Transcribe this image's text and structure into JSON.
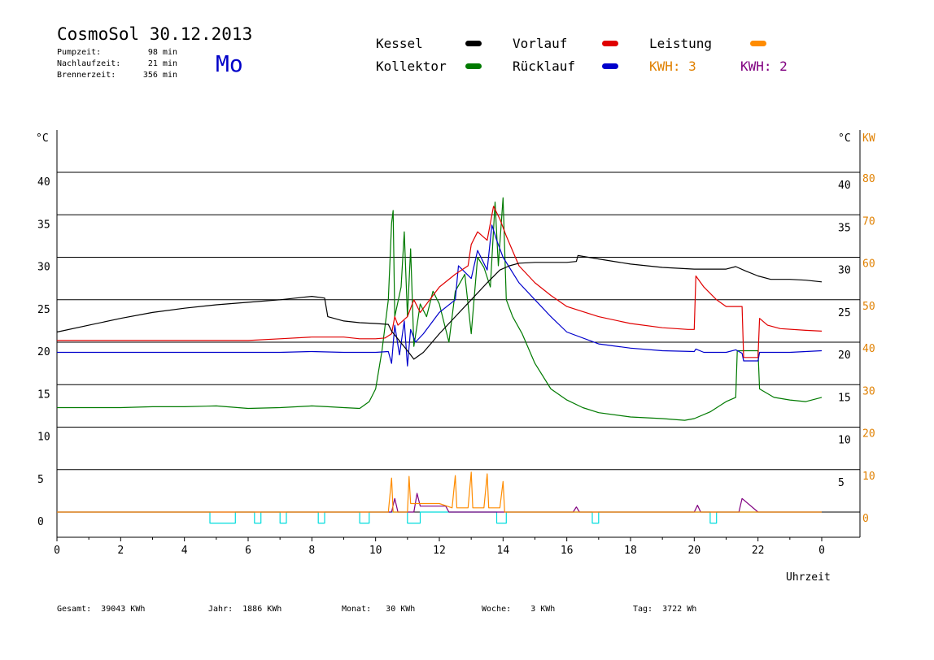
{
  "header": {
    "title": "CosmoSol 30.12.2013",
    "stats": [
      {
        "label": "Pumpzeit:",
        "value": "98 min"
      },
      {
        "label": "Nachlaufzeit:",
        "value": "21 min"
      },
      {
        "label": "Brennerzeit:",
        "value": "356 min"
      }
    ],
    "weekday": "Mo"
  },
  "legend": {
    "kessel": "Kessel",
    "kollektor": "Kollektor",
    "vorlauf": "Vorlauf",
    "ruecklauf": "Rücklauf",
    "leistung": "Leistung",
    "kwh1": "KWH: 3",
    "kwh2": "KWH: 2"
  },
  "footer": {
    "gesamt": "Gesamt:  39043 KWh",
    "jahr": "Jahr:  1886 KWh",
    "monat": "Monat:   30 KWh",
    "woche": "Woche:    3 KWh",
    "tag": "Tag:  3722 Wh"
  },
  "chart_data": {
    "type": "line",
    "x_unit": "Uhrzeit",
    "xlabel": "Uhrzeit",
    "y_unit_left": "°C",
    "y_unit_right": "°C",
    "y2_unit": "KW",
    "xlim": [
      0,
      24
    ],
    "ylim": [
      -3,
      45
    ],
    "y2lim": [
      -6,
      90
    ],
    "x_ticks": [
      0,
      2,
      4,
      6,
      8,
      10,
      12,
      14,
      16,
      18,
      20,
      22,
      24
    ],
    "x_tick_labels": [
      "0",
      "2",
      "4",
      "6",
      "8",
      "10",
      "12",
      "14",
      "16",
      "18",
      "20",
      "22",
      "0"
    ],
    "y_ticks_left": [
      0,
      5,
      10,
      15,
      20,
      25,
      30,
      35,
      40
    ],
    "y_ticks_right": [
      5,
      10,
      15,
      20,
      25,
      30,
      35,
      40
    ],
    "y2_ticks": [
      0,
      10,
      20,
      30,
      40,
      50,
      60,
      70,
      80
    ],
    "grid": true,
    "colors": {
      "kessel": "#000000",
      "vorlauf": "#e00000",
      "ruecklauf": "#0000cc",
      "kollektor": "#007a00",
      "leistung": "#ff8c00",
      "kwh1": "#e08000",
      "kwh2": "#800080",
      "pump": "#00dcdc"
    },
    "series": [
      {
        "name": "Kessel",
        "key": "kessel",
        "points": [
          [
            0,
            21.2
          ],
          [
            1,
            22
          ],
          [
            2,
            22.8
          ],
          [
            3,
            23.5
          ],
          [
            4,
            24
          ],
          [
            5,
            24.4
          ],
          [
            6,
            24.7
          ],
          [
            7,
            25
          ],
          [
            7.5,
            25.2
          ],
          [
            8,
            25.4
          ],
          [
            8.4,
            25.2
          ],
          [
            8.5,
            23
          ],
          [
            9,
            22.5
          ],
          [
            9.5,
            22.3
          ],
          [
            10,
            22.2
          ],
          [
            10.4,
            22.1
          ],
          [
            10.5,
            21.3
          ],
          [
            11,
            19
          ],
          [
            11.2,
            18
          ],
          [
            11.5,
            18.8
          ],
          [
            12,
            21
          ],
          [
            12.5,
            23
          ],
          [
            13,
            25
          ],
          [
            13.5,
            27
          ],
          [
            13.9,
            28.5
          ],
          [
            14.2,
            29
          ],
          [
            14.5,
            29.3
          ],
          [
            15,
            29.4
          ],
          [
            15.5,
            29.4
          ],
          [
            16,
            29.4
          ],
          [
            16.3,
            29.5
          ],
          [
            16.35,
            30.2
          ],
          [
            17,
            29.8
          ],
          [
            18,
            29.2
          ],
          [
            19,
            28.8
          ],
          [
            20,
            28.6
          ],
          [
            21,
            28.6
          ],
          [
            21.3,
            28.9
          ],
          [
            21.6,
            28.4
          ],
          [
            22,
            27.8
          ],
          [
            22.4,
            27.4
          ],
          [
            23,
            27.4
          ],
          [
            23.5,
            27.3
          ],
          [
            24,
            27.1
          ]
        ]
      },
      {
        "name": "Vorlauf",
        "key": "vorlauf",
        "points": [
          [
            0,
            20.2
          ],
          [
            2,
            20.2
          ],
          [
            4,
            20.2
          ],
          [
            6,
            20.2
          ],
          [
            7,
            20.4
          ],
          [
            8,
            20.6
          ],
          [
            9,
            20.6
          ],
          [
            9.5,
            20.4
          ],
          [
            10,
            20.4
          ],
          [
            10.3,
            20.5
          ],
          [
            10.5,
            21
          ],
          [
            10.6,
            23
          ],
          [
            10.7,
            22
          ],
          [
            11,
            23
          ],
          [
            11.2,
            25
          ],
          [
            11.4,
            23.5
          ],
          [
            11.6,
            24.5
          ],
          [
            12,
            26.5
          ],
          [
            12.5,
            28
          ],
          [
            12.9,
            29
          ],
          [
            13,
            31.5
          ],
          [
            13.2,
            33
          ],
          [
            13.5,
            32
          ],
          [
            13.7,
            36
          ],
          [
            13.9,
            34.5
          ],
          [
            14.1,
            32.5
          ],
          [
            14.5,
            29
          ],
          [
            15,
            27
          ],
          [
            15.5,
            25.5
          ],
          [
            16,
            24.2
          ],
          [
            17,
            23
          ],
          [
            18,
            22.2
          ],
          [
            19,
            21.7
          ],
          [
            19.8,
            21.5
          ],
          [
            20,
            21.5
          ],
          [
            20.05,
            27.8
          ],
          [
            20.3,
            26.5
          ],
          [
            20.7,
            25
          ],
          [
            21,
            24.2
          ],
          [
            21.5,
            24.2
          ],
          [
            21.55,
            18.2
          ],
          [
            22,
            18.2
          ],
          [
            22.05,
            22.8
          ],
          [
            22.3,
            22
          ],
          [
            22.7,
            21.6
          ],
          [
            23.5,
            21.4
          ],
          [
            24,
            21.3
          ]
        ]
      },
      {
        "name": "Rücklauf",
        "key": "ruecklauf",
        "points": [
          [
            0,
            18.8
          ],
          [
            2,
            18.8
          ],
          [
            4,
            18.8
          ],
          [
            6,
            18.8
          ],
          [
            7,
            18.8
          ],
          [
            8,
            18.9
          ],
          [
            9,
            18.8
          ],
          [
            10,
            18.8
          ],
          [
            10.4,
            18.9
          ],
          [
            10.5,
            17.5
          ],
          [
            10.6,
            22
          ],
          [
            10.75,
            18.5
          ],
          [
            10.9,
            22.5
          ],
          [
            11,
            17.2
          ],
          [
            11.1,
            21.5
          ],
          [
            11.25,
            20
          ],
          [
            11.5,
            21
          ],
          [
            12,
            23.5
          ],
          [
            12.5,
            25
          ],
          [
            12.6,
            29
          ],
          [
            13,
            27.5
          ],
          [
            13.2,
            30.8
          ],
          [
            13.5,
            28.5
          ],
          [
            13.65,
            33.8
          ],
          [
            13.8,
            32
          ],
          [
            14,
            30
          ],
          [
            14.5,
            27
          ],
          [
            15,
            25
          ],
          [
            15.5,
            23
          ],
          [
            16,
            21.2
          ],
          [
            17,
            19.8
          ],
          [
            18,
            19.3
          ],
          [
            19,
            19
          ],
          [
            20,
            18.9
          ],
          [
            20.05,
            19.2
          ],
          [
            20.3,
            18.8
          ],
          [
            21,
            18.8
          ],
          [
            21.3,
            19.1
          ],
          [
            21.5,
            18.7
          ],
          [
            21.55,
            17.8
          ],
          [
            22,
            17.8
          ],
          [
            22.05,
            18.8
          ],
          [
            23,
            18.8
          ],
          [
            24,
            19
          ]
        ]
      },
      {
        "name": "Kollektor",
        "key": "kollektor",
        "points": [
          [
            0,
            12.3
          ],
          [
            1,
            12.3
          ],
          [
            2,
            12.3
          ],
          [
            3,
            12.4
          ],
          [
            4,
            12.4
          ],
          [
            5,
            12.5
          ],
          [
            6,
            12.2
          ],
          [
            7,
            12.3
          ],
          [
            8,
            12.5
          ],
          [
            8.5,
            12.4
          ],
          [
            9,
            12.3
          ],
          [
            9.5,
            12.2
          ],
          [
            9.8,
            13
          ],
          [
            10,
            14.5
          ],
          [
            10.2,
            19
          ],
          [
            10.4,
            25
          ],
          [
            10.5,
            34
          ],
          [
            10.55,
            35.5
          ],
          [
            10.6,
            23
          ],
          [
            10.8,
            26.5
          ],
          [
            10.9,
            33
          ],
          [
            11,
            23
          ],
          [
            11.1,
            31
          ],
          [
            11.2,
            19.5
          ],
          [
            11.4,
            24.5
          ],
          [
            11.6,
            23
          ],
          [
            11.8,
            26
          ],
          [
            12,
            24.5
          ],
          [
            12.3,
            20
          ],
          [
            12.5,
            26
          ],
          [
            12.8,
            28
          ],
          [
            13,
            21
          ],
          [
            13.2,
            30
          ],
          [
            13.4,
            28.8
          ],
          [
            13.6,
            26.5
          ],
          [
            13.75,
            36.5
          ],
          [
            13.85,
            29
          ],
          [
            14,
            37
          ],
          [
            14.1,
            25
          ],
          [
            14.3,
            23
          ],
          [
            14.6,
            21
          ],
          [
            15,
            17.5
          ],
          [
            15.5,
            14.5
          ],
          [
            16,
            13.2
          ],
          [
            16.5,
            12.3
          ],
          [
            17,
            11.7
          ],
          [
            18,
            11.2
          ],
          [
            19,
            11
          ],
          [
            19.7,
            10.8
          ],
          [
            20,
            11
          ],
          [
            20.5,
            11.8
          ],
          [
            21,
            13
          ],
          [
            21.3,
            13.5
          ],
          [
            21.35,
            19
          ],
          [
            22,
            19
          ],
          [
            22.05,
            14.5
          ],
          [
            22.5,
            13.5
          ],
          [
            23,
            13.2
          ],
          [
            23.5,
            13
          ],
          [
            24,
            13.5
          ]
        ]
      },
      {
        "name": "Leistung",
        "key": "leistung",
        "points": [
          [
            0,
            0
          ],
          [
            10.4,
            0
          ],
          [
            10.5,
            4
          ],
          [
            10.55,
            0
          ],
          [
            11,
            0
          ],
          [
            11.05,
            4.2
          ],
          [
            11.1,
            1
          ],
          [
            11.5,
            1
          ],
          [
            12,
            1
          ],
          [
            12.4,
            0.5
          ],
          [
            12.5,
            4.3
          ],
          [
            12.55,
            0.5
          ],
          [
            12.9,
            0.5
          ],
          [
            13,
            4.7
          ],
          [
            13.05,
            0.5
          ],
          [
            13.4,
            0.5
          ],
          [
            13.5,
            4.5
          ],
          [
            13.55,
            0.5
          ],
          [
            13.9,
            0.5
          ],
          [
            14,
            3.6
          ],
          [
            14.05,
            0
          ],
          [
            24,
            0
          ]
        ]
      },
      {
        "name": "KWH: 2",
        "key": "kwh2",
        "points": [
          [
            0,
            0
          ],
          [
            10.5,
            0
          ],
          [
            10.6,
            1.6
          ],
          [
            10.7,
            0
          ],
          [
            11.2,
            0
          ],
          [
            11.3,
            2.2
          ],
          [
            11.4,
            0.7
          ],
          [
            12,
            0.7
          ],
          [
            12.2,
            0.7
          ],
          [
            12.3,
            0
          ],
          [
            16.2,
            0
          ],
          [
            16.3,
            0.6
          ],
          [
            16.4,
            0
          ],
          [
            20,
            0
          ],
          [
            20.1,
            0.8
          ],
          [
            20.2,
            0
          ],
          [
            21.4,
            0
          ],
          [
            21.5,
            1.6
          ],
          [
            22,
            0
          ],
          [
            24,
            0
          ]
        ]
      },
      {
        "name": "Pumpe",
        "key": "pump",
        "step": true,
        "points": [
          [
            0,
            0
          ],
          [
            4.8,
            0
          ],
          [
            4.8,
            -1.3
          ],
          [
            5.6,
            -1.3
          ],
          [
            5.6,
            0
          ],
          [
            6.2,
            0
          ],
          [
            6.2,
            -1.3
          ],
          [
            6.4,
            -1.3
          ],
          [
            6.4,
            0
          ],
          [
            7,
            0
          ],
          [
            7,
            -1.3
          ],
          [
            7.2,
            -1.3
          ],
          [
            7.2,
            0
          ],
          [
            8.2,
            0
          ],
          [
            8.2,
            -1.3
          ],
          [
            8.4,
            -1.3
          ],
          [
            8.4,
            0
          ],
          [
            9.5,
            0
          ],
          [
            9.5,
            -1.3
          ],
          [
            9.8,
            -1.3
          ],
          [
            9.8,
            0
          ],
          [
            11,
            0
          ],
          [
            11,
            -1.3
          ],
          [
            11.4,
            -1.3
          ],
          [
            11.4,
            0
          ],
          [
            13.8,
            0
          ],
          [
            13.8,
            -1.3
          ],
          [
            14.1,
            -1.3
          ],
          [
            14.1,
            0
          ],
          [
            16.8,
            0
          ],
          [
            16.8,
            -1.3
          ],
          [
            17,
            -1.3
          ],
          [
            17,
            0
          ],
          [
            20.5,
            0
          ],
          [
            20.5,
            -1.3
          ],
          [
            20.7,
            -1.3
          ],
          [
            20.7,
            0
          ],
          [
            24,
            0
          ]
        ]
      }
    ]
  }
}
